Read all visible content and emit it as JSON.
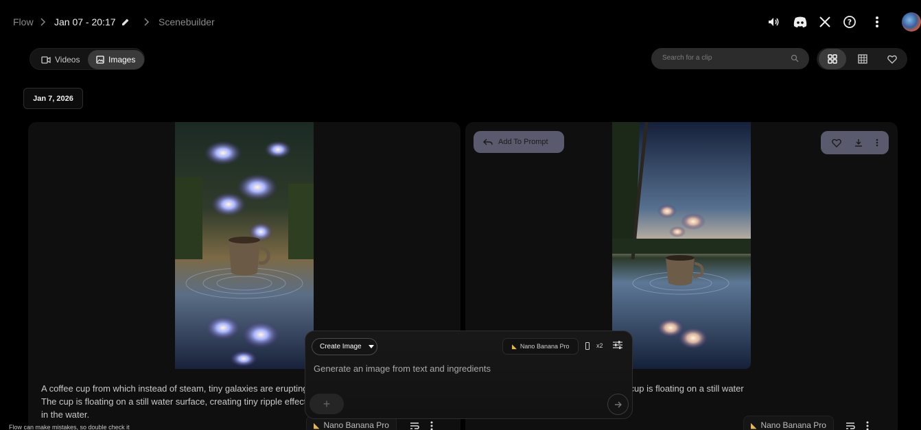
{
  "header": {
    "breadcrumb_root": "Flow",
    "project_title": "Jan 07 - 20:17",
    "breadcrumb_tool": "Scenebuilder"
  },
  "tabs": [
    {
      "label": "Videos",
      "icon": "video-icon"
    },
    {
      "label": "Images",
      "icon": "image-icon",
      "selected": true
    }
  ],
  "search": {
    "placeholder": "Search for a clip"
  },
  "date_group": "Jan 7, 2026",
  "cards": [
    {
      "caption": "A coffee cup from which instead of steam, tiny galaxies are erupting. The cup is floating on a still water surface, creating tiny ripple effects in the water.",
      "model": "Nano Banana Pro"
    },
    {
      "caption": "A coffee cup from which instead of steam, tiny galaxies are erupting. The cup is floating on a still water surface, creating tiny ripple effects in the water.",
      "model": "Nano Banana Pro",
      "add_to_prompt": "Add To Prompt"
    }
  ],
  "composer": {
    "mode_label": "Create Image",
    "model": "Nano Banana Pro",
    "count": "x2",
    "placeholder": "Generate an image from text and ingredients"
  },
  "disclaimer": "Flow can make mistakes, so double check it",
  "colors": {
    "background": "#000000",
    "card": "#0f0f0f",
    "accent_chip": "#5a5a6e"
  }
}
